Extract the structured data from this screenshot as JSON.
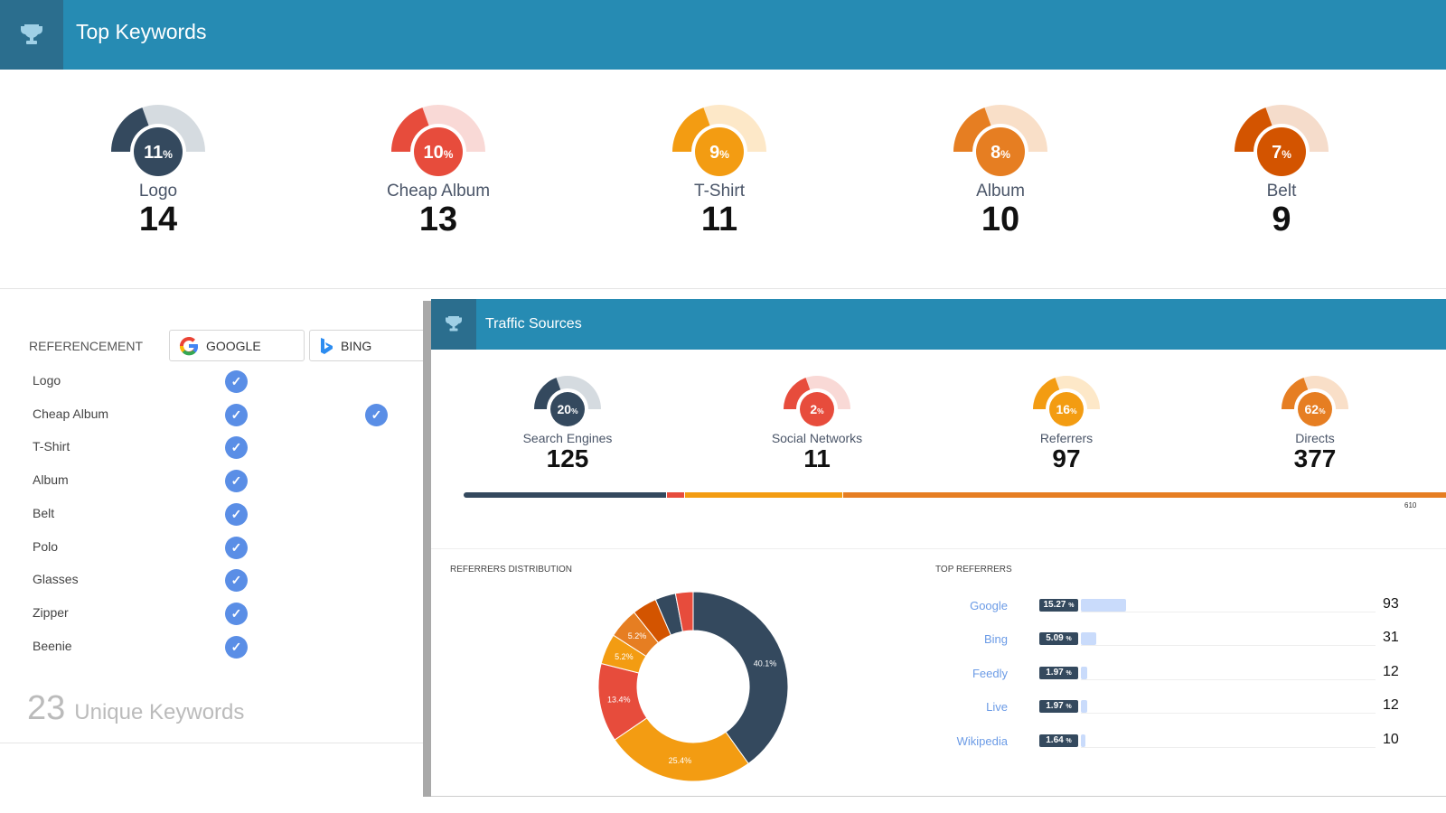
{
  "header": {
    "title": "Top Keywords",
    "icon": "trophy-icon"
  },
  "top_keywords": [
    {
      "name": "Logo",
      "percent": "11",
      "count": "14",
      "color": "#34495e",
      "light": "#d5dbe0"
    },
    {
      "name": "Cheap Album",
      "percent": "10",
      "count": "13",
      "color": "#e74c3c",
      "light": "#f9d9d6"
    },
    {
      "name": "T-Shirt",
      "percent": "9",
      "count": "11",
      "color": "#f39c12",
      "light": "#fde8c8"
    },
    {
      "name": "Album",
      "percent": "8",
      "count": "10",
      "color": "#e67e22",
      "light": "#f9dfc8"
    },
    {
      "name": "Belt",
      "percent": "7",
      "count": "9",
      "color": "#d35400",
      "light": "#f5dccb"
    }
  ],
  "percent_sign": "%",
  "referencement": {
    "label": "REFERENCEMENT",
    "engines": [
      {
        "name": "GOOGLE",
        "icon": "google-icon"
      },
      {
        "name": "BING",
        "icon": "bing-icon"
      }
    ],
    "keywords": [
      {
        "name": "Logo",
        "google": true,
        "bing": false
      },
      {
        "name": "Cheap Album",
        "google": true,
        "bing": true
      },
      {
        "name": "T-Shirt",
        "google": true,
        "bing": false
      },
      {
        "name": "Album",
        "google": true,
        "bing": false
      },
      {
        "name": "Belt",
        "google": true,
        "bing": false
      },
      {
        "name": "Polo",
        "google": true,
        "bing": false
      },
      {
        "name": "Glasses",
        "google": true,
        "bing": false
      },
      {
        "name": "Zipper",
        "google": true,
        "bing": false
      },
      {
        "name": "Beenie",
        "google": true,
        "bing": false
      }
    ],
    "unique_count": "23",
    "unique_label": "Unique Keywords"
  },
  "traffic": {
    "title": "Traffic Sources",
    "icon": "trophy-icon",
    "sources": [
      {
        "name": "Search Engines",
        "percent": "20",
        "count": "125",
        "color": "#34495e",
        "light": "#d5dbe0"
      },
      {
        "name": "Social Networks",
        "percent": "2",
        "count": "11",
        "color": "#e74c3c",
        "light": "#f9d9d6"
      },
      {
        "name": "Referrers",
        "percent": "16",
        "count": "97",
        "color": "#f39c12",
        "light": "#fde8c8"
      },
      {
        "name": "Directs",
        "percent": "62",
        "count": "377",
        "color": "#e67e22",
        "light": "#f9dfc8"
      }
    ],
    "total": "610"
  },
  "chart_data": [
    {
      "type": "pie",
      "title": "REFERRERS DISTRIBUTION",
      "donut": true,
      "values": [
        40.1,
        25.4,
        13.4,
        5.2,
        5.2,
        4.2,
        3.5,
        3.0
      ],
      "labels": [
        "40.1%",
        "25.4%",
        "13.4%",
        "5.2%",
        "5.2%",
        "",
        "",
        ""
      ],
      "colors": [
        "#34495e",
        "#f39c12",
        "#e74c3c",
        "#f39c12",
        "#e67e22",
        "#d35400",
        "#34495e",
        "#e74c3c"
      ]
    },
    {
      "type": "bar",
      "title": "TOP REFERRERS",
      "orientation": "horizontal",
      "categories": [
        "Google",
        "Bing",
        "Feedly",
        "Live",
        "Wikipedia"
      ],
      "percents": [
        "15.27",
        "5.09",
        "1.97",
        "1.97",
        "1.64"
      ],
      "values": [
        93,
        31,
        12,
        12,
        10
      ]
    }
  ]
}
